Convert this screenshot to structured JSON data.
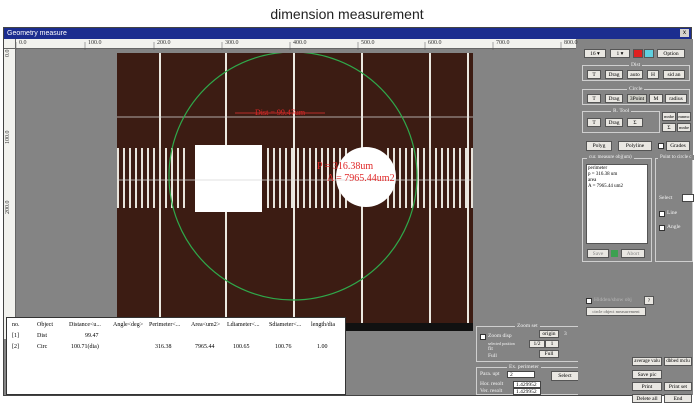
{
  "caption": "dimension measurement",
  "window": {
    "title": "Geometry measure",
    "close_glyph": "x"
  },
  "ruler_top": [
    "0.0",
    "100.0",
    "200.0",
    "300.0",
    "400.0",
    "500.0",
    "600.0",
    "700.0",
    "800.0"
  ],
  "ruler_left": [
    "0.0",
    "100.0",
    "200.0"
  ],
  "overlay": {
    "dist_label": "Dist = 99.47um",
    "circle_p": "P = 316.38um",
    "circle_a": "A = 7965.44um2"
  },
  "table": {
    "headers": [
      "no.",
      "Object",
      "Distance<u...",
      "Angle<deg>",
      "Perimeter<...",
      "Area<um2>",
      "Ldiameter<...",
      "Sdiameter<...",
      "length/dia"
    ],
    "rows": [
      [
        "[1]",
        "Dist",
        "99.47",
        "",
        "",
        "",
        "",
        "",
        ""
      ],
      [
        "[2]",
        "Circ",
        "100.71(dia)",
        "",
        "316.38",
        "7965.44",
        "100.65",
        "100.76",
        "1.00"
      ]
    ]
  },
  "toolbar": {
    "line_width": "16",
    "line_style": "1",
    "option_button": "Option",
    "color_red": "#e02020",
    "color_cyan": "#5fd0e0"
  },
  "dist_group": {
    "title": "Dist",
    "buttons": [
      "T",
      "Drag",
      "auto",
      "H",
      "sid an"
    ]
  },
  "circle_group": {
    "title": "Circle",
    "buttons": [
      "T",
      "Drag",
      "3Point",
      "M",
      "radius"
    ]
  },
  "rtool_group": {
    "title": "R. Tool",
    "buttons": [
      "T",
      "Drag",
      "Σ"
    ],
    "side_buttons": [
      "mnbe",
      "mnmc",
      "Σ",
      "mnbe"
    ]
  },
  "shape_buttons": {
    "polyg": "Polyg",
    "polyline": "Polyline",
    "grades": "Grades"
  },
  "result_box": {
    "title": "cur. measure obj(um)",
    "lines": [
      "perimeter",
      "p = 316.38 um",
      "area",
      "A = 7965.44 um2"
    ],
    "save": "Save",
    "abort": "Abort"
  },
  "point_to_circle": {
    "title": "Point to circle c",
    "select_label": "Select",
    "line_label": "Line",
    "angle_label": "Angle"
  },
  "mid_panel": {
    "hidden_label": "Hidden/show obj",
    "question": "?",
    "circle_edit": "circle object measurement"
  },
  "zoom_group": {
    "title": "Zoom set",
    "zoom_disp": "Zoom disp",
    "hint": "selected position",
    "fit": "fit",
    "full": "Full",
    "origin": "origin",
    "half": "1/2",
    "one": "1",
    "three": "3"
  },
  "perimeter_group": {
    "title": "Ex. perimeter",
    "param_label": "Para. upt",
    "param_value": "2",
    "select": "Select",
    "hor_label": "Hor. resolt",
    "hor_value": "1.429952",
    "ver_label": "Ver. resolt",
    "ver_value": "1.429952"
  },
  "action_buttons": {
    "average": "average valu",
    "dbbed": "dbbed mclu",
    "save_pic": "Save pic",
    "print": "Print",
    "print_set": "Print set",
    "delete_all": "Delete all",
    "end": "End"
  }
}
